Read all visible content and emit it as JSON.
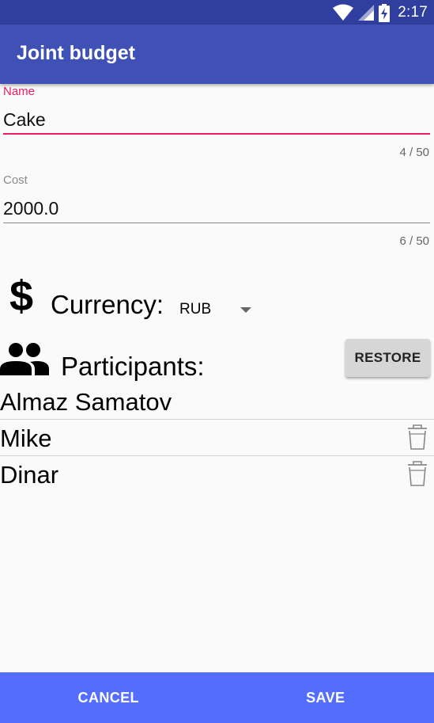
{
  "status_bar": {
    "time": "2:17",
    "icons": [
      "wifi-icon",
      "signal-icon",
      "battery-charging-icon"
    ]
  },
  "app_bar": {
    "title": "Joint budget"
  },
  "form": {
    "name": {
      "label": "Name",
      "value": "Cake",
      "counter": "4 / 50"
    },
    "cost": {
      "label": "Cost",
      "value": "2000.0",
      "counter": "6 / 50"
    }
  },
  "currency": {
    "icon": "dollar-icon",
    "label": "Currency:",
    "selected": "RUB"
  },
  "participants": {
    "icon": "people-icon",
    "label": "Participants:",
    "restore_label": "RESTORE",
    "items": [
      {
        "name": "Almaz Samatov",
        "deletable": false
      },
      {
        "name": "Mike",
        "deletable": true
      },
      {
        "name": "Dinar",
        "deletable": true
      }
    ]
  },
  "actions": {
    "cancel_label": "CANCEL",
    "save_label": "SAVE"
  },
  "colors": {
    "status_bar": "#303f9f",
    "app_bar": "#3f51b5",
    "accent": "#e91e63",
    "bottom_bar": "#536dfe"
  }
}
